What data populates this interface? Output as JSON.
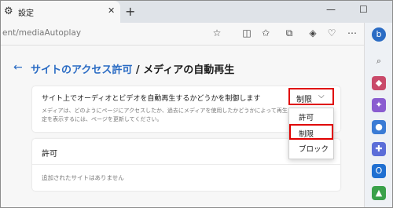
{
  "browser": {
    "tab_title": "設定",
    "tab_close": "✕",
    "new_tab": "+",
    "tab_icon": "⚙",
    "minimize": "—",
    "maximize": "☐",
    "url": "ent/mediaAutoplay"
  },
  "page": {
    "back_arrow": "←",
    "breadcrumb_link": "サイトのアクセス許可",
    "breadcrumb_sep": " / ",
    "title": "メディアの自動再生"
  },
  "autoplay": {
    "label": "サイト上でオーディオとビデオを自動再生するかどうかを制御します",
    "description_line1": "メディアは、どのようにページにアクセスしたか、過去にメディアを使用したかどうかによって再生されます。この設",
    "description_line2": "定を表示するには、ページを更新してください。",
    "selected_value": "制限",
    "chevron": "⌵",
    "options": [
      "許可",
      "制限",
      "ブロック"
    ]
  },
  "allow_section": {
    "label": "許可",
    "empty_text": "追加されたサイトはありません"
  },
  "colors": {
    "accent": "#2b6cc4",
    "highlight": "#e00000"
  }
}
